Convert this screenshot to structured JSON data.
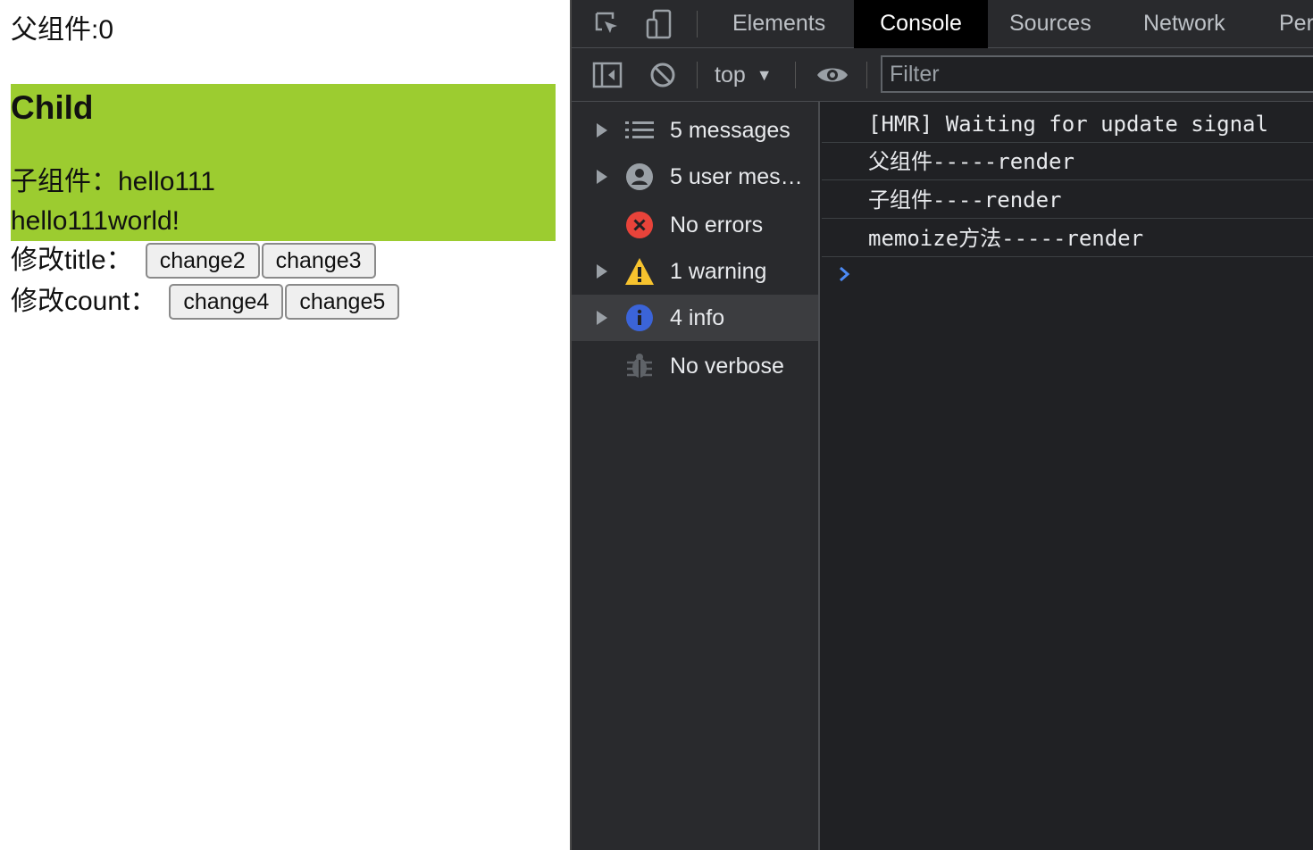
{
  "page": {
    "parent_count": "父组件:0",
    "child_title": "Child",
    "child_line1": "子组件：hello111",
    "child_line2": "hello111world!",
    "row_title_label": "修改title：",
    "row_count_label": "修改count：",
    "buttons": {
      "change2": "change2",
      "change3": "change3",
      "change4": "change4",
      "change5": "change5"
    },
    "child_bg": "#9ccc30"
  },
  "devtools": {
    "tabs": {
      "elements": "Elements",
      "console": "Console",
      "sources": "Sources",
      "network": "Network",
      "performance": "Per"
    },
    "toolbar": {
      "context": "top",
      "filter_placeholder": "Filter"
    },
    "sidebar": {
      "messages": "5 messages",
      "user_messages": "5 user mes…",
      "errors": "No errors",
      "warnings": "1 warning",
      "info": "4 info",
      "verbose": "No verbose"
    },
    "log": [
      "[HMR] Waiting for update signal",
      "父组件-----render",
      "子组件----render",
      "memoize方法-----render"
    ],
    "colors": {
      "background": "#202124",
      "error": "#e8433a",
      "warning": "#f7c32e",
      "info": "#3b64d8",
      "prompt": "#4c8af5"
    }
  }
}
